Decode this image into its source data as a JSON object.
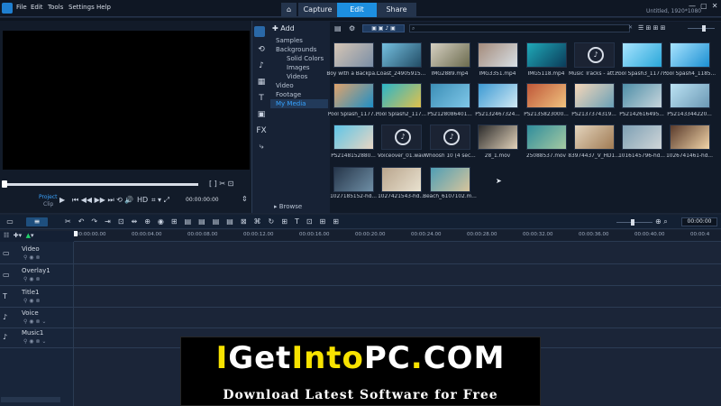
{
  "menu": [
    "File",
    "Edit",
    "Tools",
    "Settings",
    "Help"
  ],
  "tabs": [
    "Capture",
    "Edit",
    "Share"
  ],
  "status": "Untitled, 1920*1080",
  "preview": {
    "project_label": "Project",
    "clip_label": "Clip",
    "quality": "HD",
    "timecode": "00:00:00:00"
  },
  "library": {
    "add": "Add",
    "search_placeholder": "",
    "tree": [
      "Samples",
      "Backgrounds",
      "Solid Colors",
      "Images",
      "Videos",
      "Video",
      "Footage",
      "My Media"
    ],
    "browse": "Browse",
    "items": [
      {
        "label": "Boy with a Backpa...",
        "c1": "#d6c6b5",
        "c2": "#7a8ea6"
      },
      {
        "label": "Coast_24905915...",
        "c1": "#75c0e0",
        "c2": "#224d66"
      },
      {
        "label": "IMG2889.mp4",
        "c1": "#d6d0c2",
        "c2": "#6b6b4e"
      },
      {
        "label": "IMG3351.mp4",
        "c1": "#a48b7b",
        "c2": "#d8e0e6"
      },
      {
        "label": "IMG5118.mp4",
        "c1": "#1fa9b8",
        "c2": "#0b3c5a"
      },
      {
        "label": "Music Tracks - att...",
        "c1": "#1c2333",
        "c2": "#1c2333",
        "music": true
      },
      {
        "label": "Pool Spash3_1177...",
        "c1": "#a8e4ff",
        "c2": "#2aa7d9"
      },
      {
        "label": "Pool Spash4_1185...",
        "c1": "#a8e4ff",
        "c2": "#1c8fd2"
      },
      {
        "label": "Pool Splash_1177...",
        "c1": "#e0a36b",
        "c2": "#1f8fc6"
      },
      {
        "label": "Pool Splash2_117...",
        "c1": "#2bb5c9",
        "c2": "#e0c14c"
      },
      {
        "label": "PS2128086401...",
        "c1": "#3c8fb7",
        "c2": "#80c7e8"
      },
      {
        "label": "PS2132467324...",
        "c1": "#3c9ad3",
        "c2": "#d1e9f4"
      },
      {
        "label": "PS2135823000...",
        "c1": "#bf5738",
        "c2": "#f0c380"
      },
      {
        "label": "PS2137374319...",
        "c1": "#f6d7b8",
        "c2": "#6aa0b7"
      },
      {
        "label": "PS2142616495...",
        "c1": "#4e8fa8",
        "c2": "#c8d5dc"
      },
      {
        "label": "PS2143344220...",
        "c1": "#bce3f4",
        "c2": "#6b98b4"
      },
      {
        "label": "PS2148152880...",
        "c1": "#5fc5e6",
        "c2": "#e8d6c4"
      },
      {
        "label": "Voiceover_01.wav",
        "c1": "#1c2333",
        "c2": "#1c2333",
        "music": true
      },
      {
        "label": "Whoosh 10 (4 sec...",
        "c1": "#1c2333",
        "c2": "#1c2333",
        "music": true
      },
      {
        "label": "28_1.mov",
        "c1": "#2b2b2b",
        "c2": "#e2d2ba"
      },
      {
        "label": "25088537.mov",
        "c1": "#2f8d9c",
        "c2": "#a5c9a2"
      },
      {
        "label": "83974437_V_HD1...",
        "c1": "#e3d4bd",
        "c2": "#a07b54"
      },
      {
        "label": "1016145796-hd...",
        "c1": "#7ea0b4",
        "c2": "#cfd5d8"
      },
      {
        "label": "1026741461-hd...",
        "c1": "#5a3b2c",
        "c2": "#f1d4a8"
      },
      {
        "label": "1027185152-hd...",
        "c1": "#26364a",
        "c2": "#6f8fa6"
      },
      {
        "label": "1027421543-hd...",
        "c1": "#b9a58d",
        "c2": "#e9e2d0"
      },
      {
        "label": "Beach_6107102.m...",
        "c1": "#4f9eb5",
        "c2": "#d8c59c"
      }
    ]
  },
  "timeline": {
    "timecode": "00:00:00",
    "ruler": [
      "00:00:00.00",
      "00:00:04.00",
      "00:00:08.00",
      "00:00:12.00",
      "00:00:16.00",
      "00:00:20.00",
      "00:00:24.00",
      "00:00:28.00",
      "00:00:32.00",
      "00:00:36.00",
      "00:00:40.00",
      "00:00:4"
    ],
    "tracks": [
      "Video",
      "Overlay1",
      "Title1",
      "Voice",
      "Music1"
    ]
  },
  "banner": {
    "title_i": "I",
    "title_get": "Get",
    "title_into": "Into",
    "title_pc": "PC",
    "title_dot": ".",
    "title_com": "COM",
    "subtitle": "Download Latest Software for Free"
  },
  "colors": {
    "accent": "#1d8fe0",
    "yellow": "#f7e200"
  }
}
